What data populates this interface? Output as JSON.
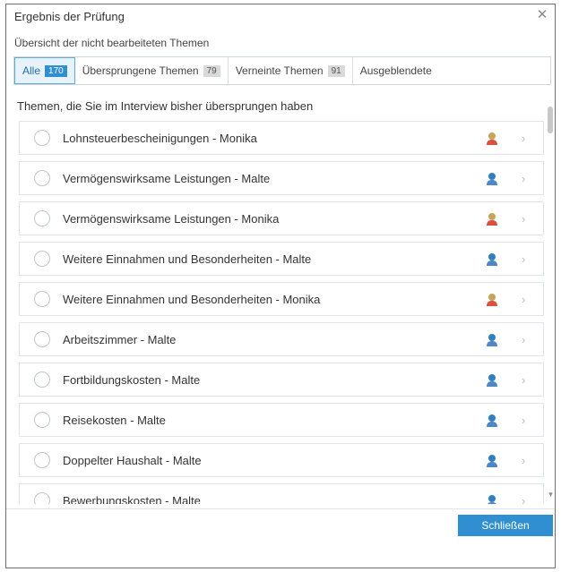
{
  "window": {
    "title": "Ergebnis der Prüfung",
    "close_icon": "close-icon"
  },
  "subtitle": "Übersicht der nicht bearbeiteten Themen",
  "tabs": [
    {
      "label": "Alle",
      "count": "170",
      "active": true
    },
    {
      "label": "Übersprungene Themen",
      "count": "79",
      "active": false
    },
    {
      "label": "Verneinte Themen",
      "count": "91",
      "active": false
    },
    {
      "label": "Ausgeblendete",
      "count": "",
      "active": false
    }
  ],
  "section_title": "Themen, die Sie im Interview bisher übersprungen haben",
  "items": [
    {
      "label": "Lohnsteuerbescheinigungen - Monika",
      "person": "female",
      "icon": "female-user-icon"
    },
    {
      "label": "Vermögenswirksame Leistungen - Malte",
      "person": "male",
      "icon": "male-user-icon"
    },
    {
      "label": "Vermögenswirksame Leistungen - Monika",
      "person": "female",
      "icon": "female-user-icon"
    },
    {
      "label": "Weitere Einnahmen und Besonderheiten - Malte",
      "person": "male",
      "icon": "male-user-icon"
    },
    {
      "label": "Weitere Einnahmen und Besonderheiten - Monika",
      "person": "female",
      "icon": "female-user-icon"
    },
    {
      "label": "Arbeitszimmer - Malte",
      "person": "male",
      "icon": "male-user-icon"
    },
    {
      "label": "Fortbildungskosten - Malte",
      "person": "male",
      "icon": "male-user-icon"
    },
    {
      "label": "Reisekosten - Malte",
      "person": "male",
      "icon": "male-user-icon"
    },
    {
      "label": "Doppelter Haushalt - Malte",
      "person": "male",
      "icon": "male-user-icon"
    },
    {
      "label": "Bewerbungskosten - Malte",
      "person": "male",
      "icon": "male-user-icon"
    }
  ],
  "footer": {
    "close_label": "Schließen"
  },
  "colors": {
    "accent": "#2f8fd1",
    "female": "#c9a35a",
    "female_body": "#d7533f",
    "male": "#2f7fc1",
    "male_body": "#4e86c6"
  }
}
